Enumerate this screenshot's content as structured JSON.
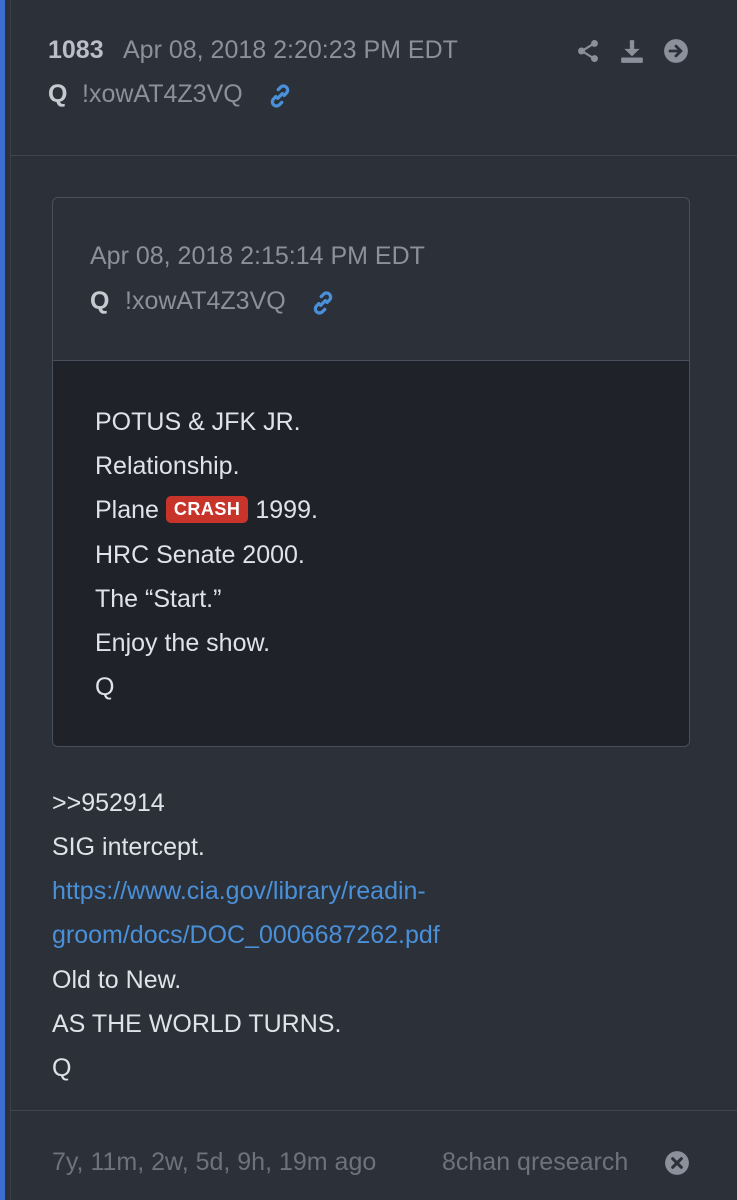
{
  "post": {
    "number": "1083",
    "date": "Apr 08, 2018 2:20:23 PM EDT",
    "author": "Q",
    "tripcode": "!xowAT4Z3VQ"
  },
  "quoted": {
    "date": "Apr 08, 2018 2:15:14 PM EDT",
    "author": "Q",
    "tripcode": "!xowAT4Z3VQ",
    "lines": {
      "l1": "POTUS & JFK JR.",
      "l2": "Relationship.",
      "l3_pre": "Plane ",
      "l3_badge": "CRASH",
      "l3_post": " 1999.",
      "l4": "HRC Senate 2000.",
      "l5": "The “Start.”",
      "l6": "Enjoy the show.",
      "l7": "Q"
    }
  },
  "body": {
    "reply_ref": ">>952914",
    "line2": "SIG intercept.",
    "link_part1": "https://www.cia.gov/library/readin-",
    "link_part2": "groom/docs/DOC_0006687262.pdf",
    "line4": "Old to New.",
    "line5": "AS THE WORLD TURNS.",
    "line6": "Q"
  },
  "footer": {
    "ago": "7y, 11m, 2w, 5d, 9h, 19m ago",
    "source": "8chan qresearch"
  },
  "icons": [
    "share-icon",
    "download-icon",
    "arrow-right-circle-icon",
    "link-icon",
    "close-circle-icon"
  ],
  "colors": {
    "background": "#2b3039",
    "quote_body": "#1f2329",
    "accent": "#3b6ecf",
    "link": "#4a90d9",
    "badge": "#c9342a"
  }
}
